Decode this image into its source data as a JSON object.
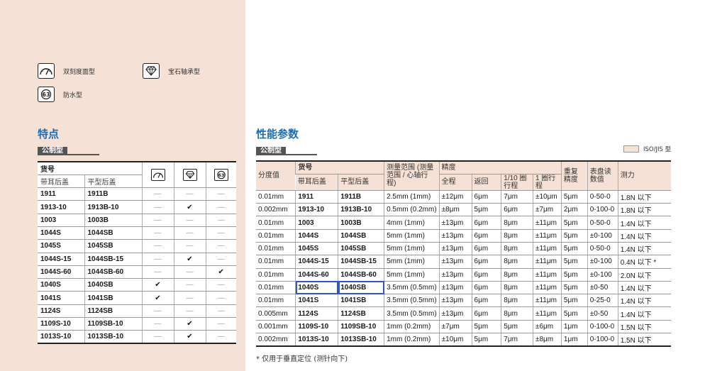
{
  "legend": {
    "dual_dial": "双刻度面型",
    "jewel_bearing": "宝石轴承型",
    "waterproof": "防水型"
  },
  "features": {
    "title": "特点",
    "tag": "公制型",
    "header": {
      "code": "货号",
      "lug_back": "带耳后盖",
      "flat_back": "平型后盖"
    },
    "dash": "—",
    "check": "✔",
    "rows": [
      {
        "lug": "1911",
        "flat": "1911B",
        "dual": false,
        "jewel": false,
        "water": false
      },
      {
        "lug": "1913-10",
        "flat": "1913B-10",
        "dual": false,
        "jewel": true,
        "water": false
      },
      {
        "lug": "1003",
        "flat": "1003B",
        "dual": false,
        "jewel": false,
        "water": false
      },
      {
        "lug": "1044S",
        "flat": "1044SB",
        "dual": false,
        "jewel": false,
        "water": false
      },
      {
        "lug": "1045S",
        "flat": "1045SB",
        "dual": false,
        "jewel": false,
        "water": false
      },
      {
        "lug": "1044S-15",
        "flat": "1044SB-15",
        "dual": false,
        "jewel": true,
        "water": false
      },
      {
        "lug": "1044S-60",
        "flat": "1044SB-60",
        "dual": false,
        "jewel": false,
        "water": true
      },
      {
        "lug": "1040S",
        "flat": "1040SB",
        "dual": true,
        "jewel": false,
        "water": false
      },
      {
        "lug": "1041S",
        "flat": "1041SB",
        "dual": true,
        "jewel": false,
        "water": false
      },
      {
        "lug": "1124S",
        "flat": "1124SB",
        "dual": false,
        "jewel": false,
        "water": false
      },
      {
        "lug": "1109S-10",
        "flat": "1109SB-10",
        "dual": false,
        "jewel": true,
        "water": false
      },
      {
        "lug": "1013S-10",
        "flat": "1013SB-10",
        "dual": false,
        "jewel": true,
        "water": false
      }
    ]
  },
  "specs": {
    "title": "性能参数",
    "tag": "公制型",
    "iso_label": "ISO/JIS 型",
    "header": {
      "graduation": "分度值",
      "code": "货号",
      "lug_back": "带耳后盖",
      "flat_back": "平型后盖",
      "range": "测量范围 (测量范围 / 心轴行程)",
      "accuracy": "精度",
      "full_range": "全程",
      "retrace": "返回",
      "tenth_rev": "1/10 圈行程",
      "one_rev": "1 圈行程",
      "repeatability": "重复精度",
      "dial_reading": "表盘读数值",
      "force": "测力"
    },
    "rows": [
      [
        "0.01mm",
        "1911",
        "1911B",
        "2.5mm (1mm)",
        "±12μm",
        "6μm",
        "7μm",
        "±10μm",
        "5μm",
        "0-50-0",
        "1.8N 以下"
      ],
      [
        "0.002mm",
        "1913-10",
        "1913B-10",
        "0.5mm (0.2mm)",
        "±8μm",
        "5μm",
        "6μm",
        "±7μm",
        "2μm",
        "0-100-0",
        "1.8N 以下"
      ],
      [
        "0.01mm",
        "1003",
        "1003B",
        "4mm (1mm)",
        "±13μm",
        "6μm",
        "8μm",
        "±11μm",
        "5μm",
        "0-50-0",
        "1.4N 以下"
      ],
      [
        "0.01mm",
        "1044S",
        "1044SB",
        "5mm (1mm)",
        "±13μm",
        "6μm",
        "8μm",
        "±11μm",
        "5μm",
        "±0-100",
        "1.4N 以下"
      ],
      [
        "0.01mm",
        "1045S",
        "1045SB",
        "5mm (1mm)",
        "±13μm",
        "6μm",
        "8μm",
        "±11μm",
        "5μm",
        "0-50-0",
        "1.4N 以下"
      ],
      [
        "0.01mm",
        "1044S-15",
        "1044SB-15",
        "5mm (1mm)",
        "±13μm",
        "6μm",
        "8μm",
        "±11μm",
        "5μm",
        "±0-100",
        "0.4N 以下 *"
      ],
      [
        "0.01mm",
        "1044S-60",
        "1044SB-60",
        "5mm (1mm)",
        "±13μm",
        "6μm",
        "8μm",
        "±11μm",
        "5μm",
        "±0-100",
        "2.0N 以下"
      ],
      [
        "0.01mm",
        "1040S",
        "1040SB",
        "3.5mm (0.5mm)",
        "±13μm",
        "6μm",
        "8μm",
        "±11μm",
        "5μm",
        "±0-50",
        "1.4N 以下"
      ],
      [
        "0.01mm",
        "1041S",
        "1041SB",
        "3.5mm (0.5mm)",
        "±13μm",
        "6μm",
        "8μm",
        "±11μm",
        "5μm",
        "0-25-0",
        "1.4N 以下"
      ],
      [
        "0.005mm",
        "1124S",
        "1124SB",
        "3.5mm (0.5mm)",
        "±13μm",
        "6μm",
        "8μm",
        "±11μm",
        "5μm",
        "±0-50",
        "1.4N 以下"
      ],
      [
        "0.001mm",
        "1109S-10",
        "1109SB-10",
        "1mm (0.2mm)",
        "±7μm",
        "5μm",
        "5μm",
        "±6μm",
        "1μm",
        "0-100-0",
        "1.5N 以下"
      ],
      [
        "0.002mm",
        "1013S-10",
        "1013SB-10",
        "1mm (0.2mm)",
        "±10μm",
        "5μm",
        "7μm",
        "±8μm",
        "1μm",
        "0-100-0",
        "1.5N 以下"
      ]
    ],
    "footnote": "* 仅用于垂直定位 (测针向下)"
  },
  "colors": {
    "panel": "#f5e1d6",
    "title": "#1e6db0",
    "highlight": "#2f57c9"
  }
}
